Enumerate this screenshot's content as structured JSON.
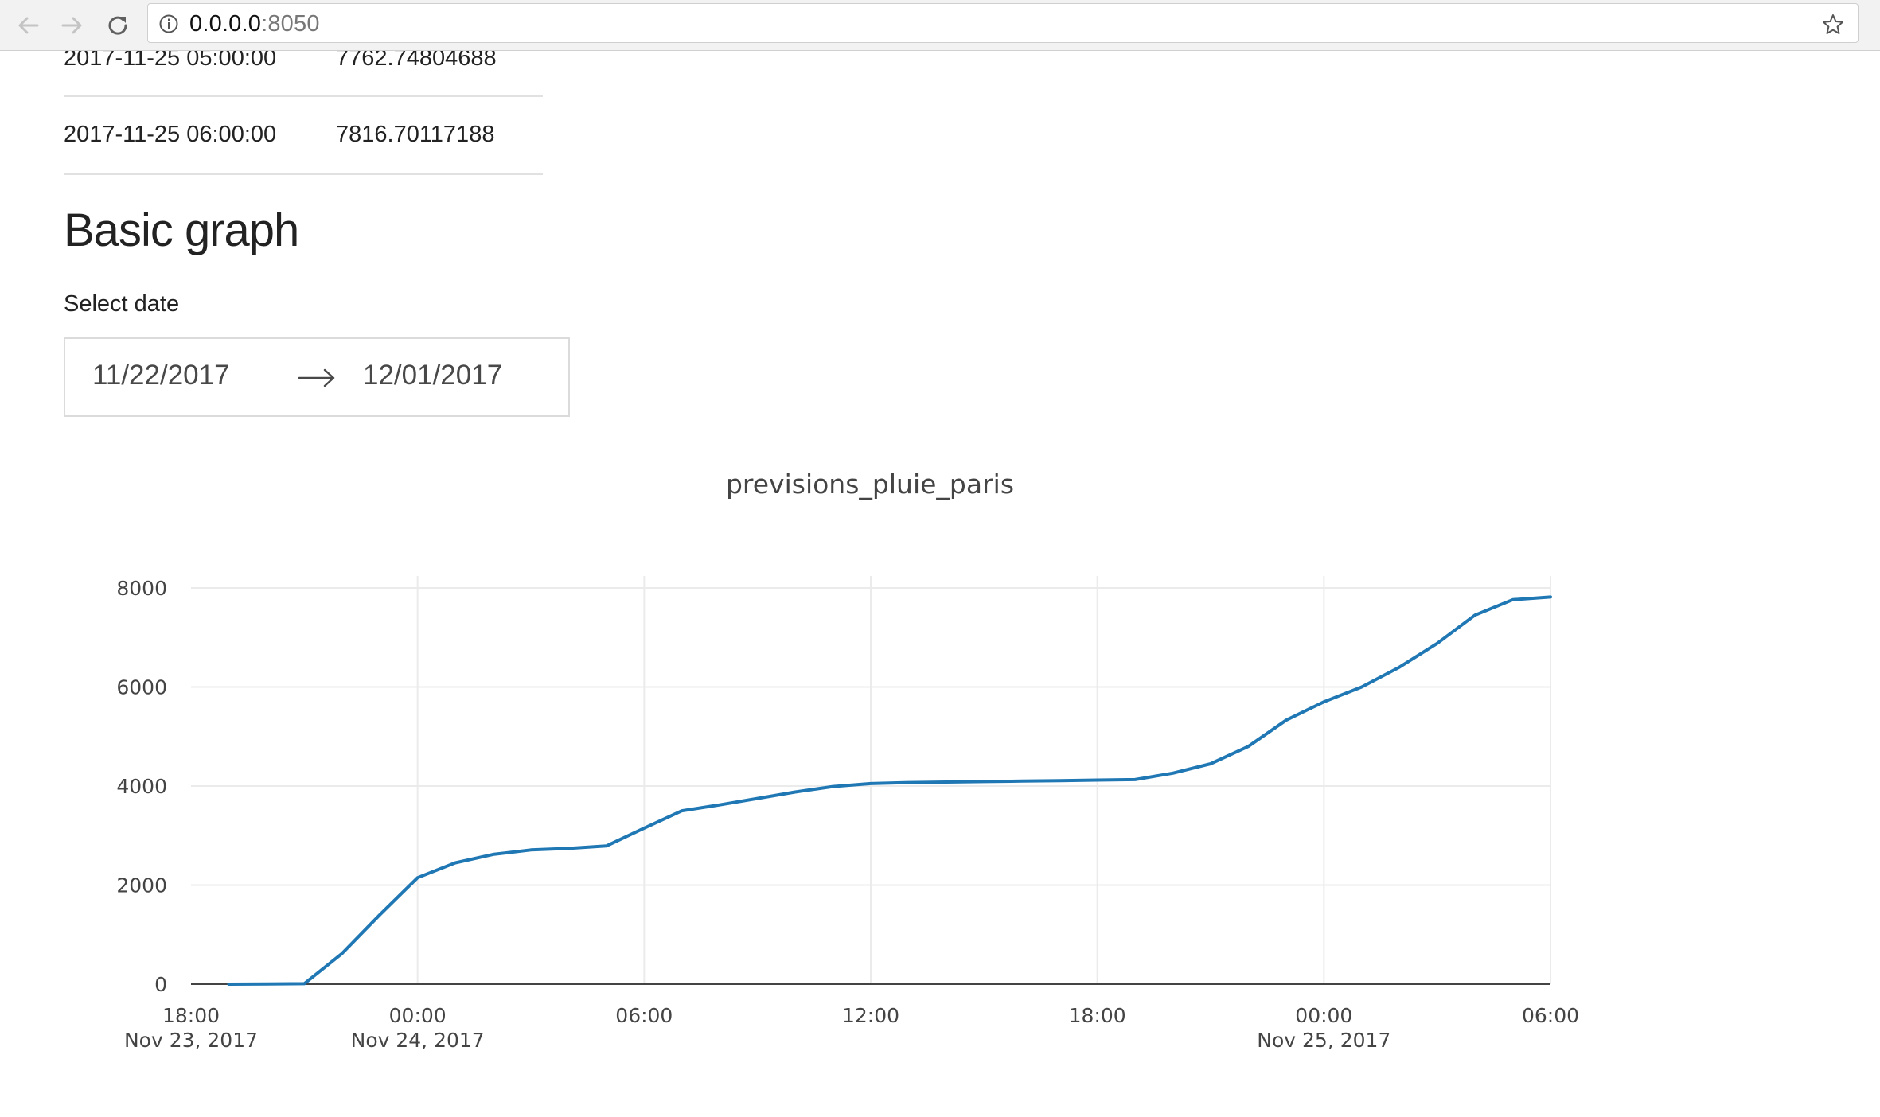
{
  "browser": {
    "url_host": "0.0.0.0",
    "url_port": ":8050",
    "icons": [
      "back-arrow-icon",
      "forward-arrow-icon",
      "reload-icon",
      "info-icon",
      "star-icon"
    ]
  },
  "table": {
    "rows": [
      {
        "date": "2017-11-25 05:00:00",
        "value": "7762.74804688"
      },
      {
        "date": "2017-11-25 06:00:00",
        "value": "7816.70117188"
      }
    ]
  },
  "graph_section": {
    "title": "Basic graph",
    "date_label": "Select date",
    "start_date": "11/22/2017",
    "end_date": "12/01/2017"
  },
  "chart_data": {
    "type": "line",
    "title": "previsions_pluie_paris",
    "xlabel": "",
    "ylabel": "",
    "ylim": [
      0,
      8000
    ],
    "yticks": [
      "0",
      "2000",
      "4000",
      "6000",
      "8000"
    ],
    "xlim": [
      "2017-11-23 18:00",
      "2017-11-25 06:00"
    ],
    "xticks": [
      {
        "time": "2017-11-23 18:00",
        "label1": "18:00",
        "label2": "Nov 23, 2017"
      },
      {
        "time": "2017-11-24 00:00",
        "label1": "00:00",
        "label2": "Nov 24, 2017"
      },
      {
        "time": "2017-11-24 06:00",
        "label1": "06:00",
        "label2": ""
      },
      {
        "time": "2017-11-24 12:00",
        "label1": "12:00",
        "label2": ""
      },
      {
        "time": "2017-11-24 18:00",
        "label1": "18:00",
        "label2": ""
      },
      {
        "time": "2017-11-25 00:00",
        "label1": "00:00",
        "label2": "Nov 25, 2017"
      },
      {
        "time": "2017-11-25 06:00",
        "label1": "06:00",
        "label2": ""
      }
    ],
    "grid": true,
    "line_color": "#1f77b4",
    "series": [
      {
        "x": [
          "2017-11-23 19:00",
          "2017-11-23 20:00",
          "2017-11-23 21:00",
          "2017-11-23 22:00",
          "2017-11-23 23:00",
          "2017-11-24 00:00",
          "2017-11-24 01:00",
          "2017-11-24 02:00",
          "2017-11-24 03:00",
          "2017-11-24 04:00",
          "2017-11-24 05:00",
          "2017-11-24 06:00",
          "2017-11-24 07:00",
          "2017-11-24 08:00",
          "2017-11-24 09:00",
          "2017-11-24 10:00",
          "2017-11-24 11:00",
          "2017-11-24 12:00",
          "2017-11-24 13:00",
          "2017-11-24 14:00",
          "2017-11-24 15:00",
          "2017-11-24 16:00",
          "2017-11-24 17:00",
          "2017-11-24 18:00",
          "2017-11-24 19:00",
          "2017-11-24 20:00",
          "2017-11-24 21:00",
          "2017-11-24 22:00",
          "2017-11-24 23:00",
          "2017-11-25 00:00",
          "2017-11-25 01:00",
          "2017-11-25 02:00",
          "2017-11-25 03:00",
          "2017-11-25 04:00",
          "2017-11-25 05:00",
          "2017-11-25 06:00"
        ],
        "y": [
          0,
          5,
          10,
          620,
          1400,
          2150,
          2450,
          2620,
          2710,
          2740,
          2790,
          3150,
          3500,
          3620,
          3750,
          3880,
          3990,
          4050,
          4070,
          4080,
          4090,
          4100,
          4110,
          4120,
          4130,
          4260,
          4450,
          4800,
          5330,
          5700,
          6000,
          6400,
          6880,
          7450,
          7762.74804688,
          7816.70117188
        ]
      }
    ]
  }
}
